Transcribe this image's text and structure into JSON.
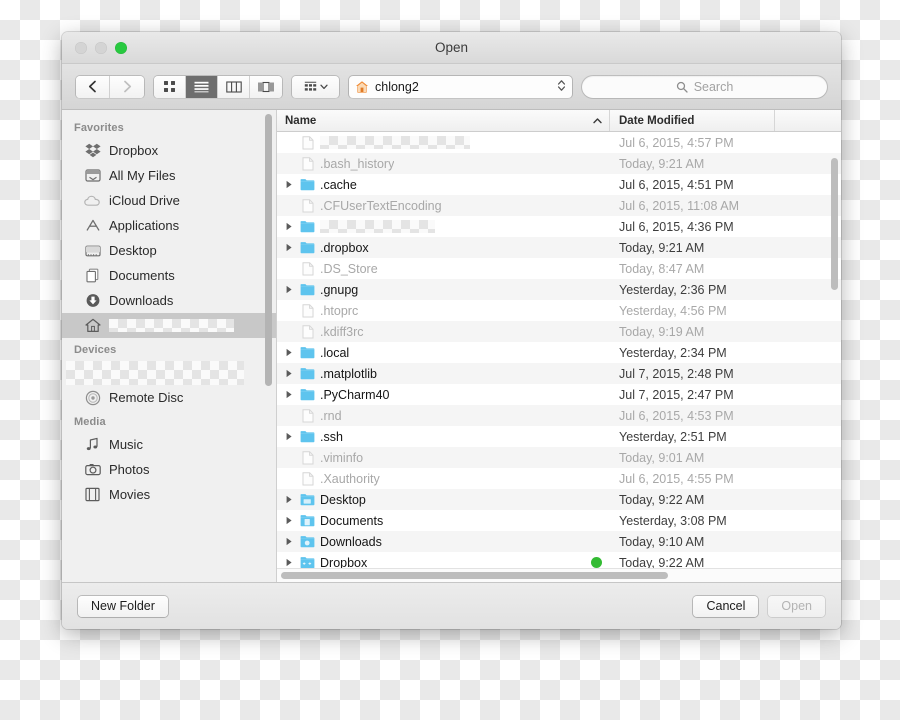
{
  "window": {
    "title": "Open",
    "traffic_lights": [
      "close-gray",
      "minimize-gray",
      "zoom-green"
    ]
  },
  "toolbar": {
    "back_icon": "chevron-left-icon",
    "forward_icon": "chevron-right-icon",
    "view_modes": [
      {
        "name": "icon-view",
        "icon": "grid-icon",
        "active": false
      },
      {
        "name": "list-view",
        "icon": "list-icon",
        "active": true
      },
      {
        "name": "column-view",
        "icon": "columns-icon",
        "active": false
      },
      {
        "name": "coverflow-view",
        "icon": "coverflow-icon",
        "active": false
      }
    ],
    "arrange": {
      "icon": "arrange-grid-icon",
      "chevron": "chevron-down-icon"
    },
    "path_popup": {
      "icon": "home-icon",
      "label": "chlong2",
      "stepper": "up-down-stepper"
    },
    "search": {
      "icon": "search-icon",
      "placeholder": "Search",
      "value": ""
    }
  },
  "sidebar": {
    "sections": [
      {
        "title": "Favorites",
        "items": [
          {
            "label": "Dropbox",
            "icon": "dropbox-icon",
            "selected": false
          },
          {
            "label": "All My Files",
            "icon": "all-my-files-icon",
            "selected": false
          },
          {
            "label": "iCloud Drive",
            "icon": "icloud-icon",
            "selected": false
          },
          {
            "label": "Applications",
            "icon": "applications-icon",
            "selected": false
          },
          {
            "label": "Desktop",
            "icon": "desktop-icon",
            "selected": false
          },
          {
            "label": "Documents",
            "icon": "documents-icon",
            "selected": false
          },
          {
            "label": "Downloads",
            "icon": "downloads-icon",
            "selected": false
          },
          {
            "label": "",
            "icon": "home-icon",
            "selected": true,
            "redacted": true
          }
        ]
      },
      {
        "title": "Devices",
        "items": [
          {
            "label": "",
            "icon": "disk-icon",
            "selected": false,
            "redacted": true
          },
          {
            "label": "Remote Disc",
            "icon": "optical-disc-icon",
            "selected": false
          }
        ]
      },
      {
        "title": "Media",
        "items": [
          {
            "label": "Music",
            "icon": "music-note-icon",
            "selected": false
          },
          {
            "label": "Photos",
            "icon": "camera-icon",
            "selected": false
          },
          {
            "label": "Movies",
            "icon": "film-icon",
            "selected": false
          }
        ]
      }
    ]
  },
  "file_list": {
    "columns": [
      {
        "label": "Name",
        "sort_icon": "chevron-up-icon",
        "sorted": true
      },
      {
        "label": "Date Modified",
        "sorted": false
      },
      {
        "label": ""
      }
    ],
    "rows": [
      {
        "name": "",
        "redacted": true,
        "kind": "file",
        "expandable": false,
        "date": "Jul 6, 2015, 4:57 PM",
        "dim": true
      },
      {
        "name": ".bash_history",
        "kind": "file",
        "expandable": false,
        "date": "Today, 9:21 AM",
        "dim": true
      },
      {
        "name": ".cache",
        "kind": "folder",
        "expandable": true,
        "date": "Jul 6, 2015, 4:51 PM",
        "dim": false
      },
      {
        "name": ".CFUserTextEncoding",
        "kind": "file",
        "expandable": false,
        "date": "Jul 6, 2015, 11:08 AM",
        "dim": true
      },
      {
        "name": "",
        "redacted": true,
        "kind": "folder",
        "expandable": true,
        "date": "Jul 6, 2015, 4:36 PM",
        "dim": false
      },
      {
        "name": ".dropbox",
        "kind": "folder",
        "expandable": true,
        "date": "Today, 9:21 AM",
        "dim": false
      },
      {
        "name": ".DS_Store",
        "kind": "file",
        "expandable": false,
        "date": "Today, 8:47 AM",
        "dim": true
      },
      {
        "name": ".gnupg",
        "kind": "folder",
        "expandable": true,
        "date": "Yesterday, 2:36 PM",
        "dim": false
      },
      {
        "name": ".htoprc",
        "kind": "file",
        "expandable": false,
        "date": "Yesterday, 4:56 PM",
        "dim": true
      },
      {
        "name": ".kdiff3rc",
        "kind": "file",
        "expandable": false,
        "date": "Today, 9:19 AM",
        "dim": true
      },
      {
        "name": ".local",
        "kind": "folder",
        "expandable": true,
        "date": "Yesterday, 2:34 PM",
        "dim": false
      },
      {
        "name": ".matplotlib",
        "kind": "folder",
        "expandable": true,
        "date": "Jul 7, 2015, 2:48 PM",
        "dim": false
      },
      {
        "name": ".PyCharm40",
        "kind": "folder",
        "expandable": true,
        "date": "Jul 7, 2015, 2:47 PM",
        "dim": false
      },
      {
        "name": ".rnd",
        "kind": "file",
        "expandable": false,
        "date": "Jul 6, 2015, 4:53 PM",
        "dim": true
      },
      {
        "name": ".ssh",
        "kind": "folder",
        "expandable": true,
        "date": "Yesterday, 2:51 PM",
        "dim": false
      },
      {
        "name": ".viminfo",
        "kind": "file",
        "expandable": false,
        "date": "Today, 9:01 AM",
        "dim": true
      },
      {
        "name": ".Xauthority",
        "kind": "file",
        "expandable": false,
        "date": "Jul 6, 2015, 4:55 PM",
        "dim": true
      },
      {
        "name": "Desktop",
        "kind": "folder-desktop",
        "expandable": true,
        "date": "Today, 9:22 AM",
        "dim": false
      },
      {
        "name": "Documents",
        "kind": "folder-documents",
        "expandable": true,
        "date": "Yesterday, 3:08 PM",
        "dim": false
      },
      {
        "name": "Downloads",
        "kind": "folder-downloads",
        "expandable": true,
        "date": "Today, 9:10 AM",
        "dim": false
      },
      {
        "name": "Dropbox",
        "kind": "folder-dropbox",
        "expandable": true,
        "date": "Today, 9:22 AM",
        "dim": false,
        "badge": "green-sync-dot"
      }
    ]
  },
  "bottom_bar": {
    "new_folder_label": "New Folder",
    "cancel_label": "Cancel",
    "open_label": "Open",
    "open_disabled": true
  },
  "colors": {
    "folder_blue": "#5ec4ee",
    "zoom_green": "#28c940",
    "sync_green": "#33bb33",
    "selection_gray": "#c8c8c8"
  }
}
